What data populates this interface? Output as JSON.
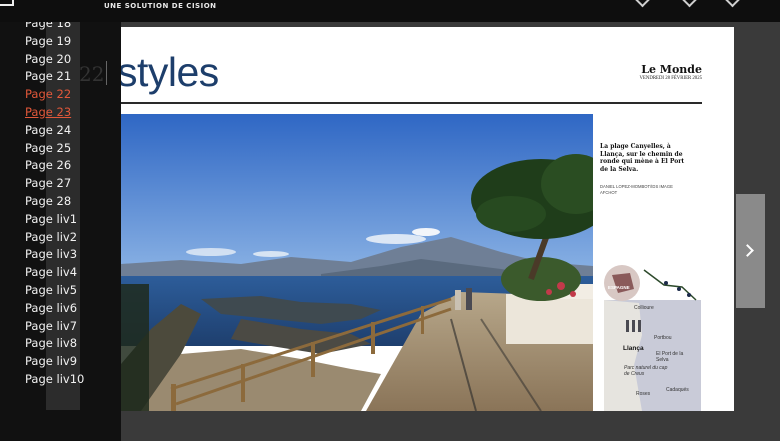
{
  "header": {
    "tagline": "UNE SOLUTION DE CISION"
  },
  "sidebar": {
    "pages": [
      {
        "label": "Page 18",
        "state": "normal"
      },
      {
        "label": "Page 19",
        "state": "normal"
      },
      {
        "label": "Page 20",
        "state": "normal"
      },
      {
        "label": "Page 21",
        "state": "normal"
      },
      {
        "label": "Page 22",
        "state": "active"
      },
      {
        "label": "Page 23",
        "state": "current"
      },
      {
        "label": "Page 24",
        "state": "normal"
      },
      {
        "label": "Page 25",
        "state": "normal"
      },
      {
        "label": "Page 26",
        "state": "normal"
      },
      {
        "label": "Page 27",
        "state": "normal"
      },
      {
        "label": "Page 28",
        "state": "normal"
      },
      {
        "label": "Page liv1",
        "state": "normal"
      },
      {
        "label": "Page liv2",
        "state": "normal"
      },
      {
        "label": "Page liv3",
        "state": "normal"
      },
      {
        "label": "Page liv4",
        "state": "normal"
      },
      {
        "label": "Page liv5",
        "state": "normal"
      },
      {
        "label": "Page liv6",
        "state": "normal"
      },
      {
        "label": "Page liv7",
        "state": "normal"
      },
      {
        "label": "Page liv8",
        "state": "normal"
      },
      {
        "label": "Page liv9",
        "state": "normal"
      },
      {
        "label": "Page liv10",
        "state": "normal"
      }
    ]
  },
  "page": {
    "number": "22",
    "section": "styles",
    "masthead": "Le Monde",
    "date": "VENDREDI 28 FÉVRIER 2025",
    "caption": "La plage Canyelles, à Llança, sur le chemin de ronde qui mène à El Port de la Selva.",
    "credit": "DANIEL LOPEZ-MOMBOT/IDS IMAGE AFCHOT",
    "map": {
      "country": "ESPAGNE",
      "labels": [
        "Collioure",
        "Portbou",
        "Llança",
        "El Port de la Selva",
        "Parc naturel du cap de Creus",
        "Roses",
        "Cadaqués"
      ]
    }
  },
  "colors": {
    "accent": "#e2583a",
    "section_title": "#1d3e6b"
  }
}
